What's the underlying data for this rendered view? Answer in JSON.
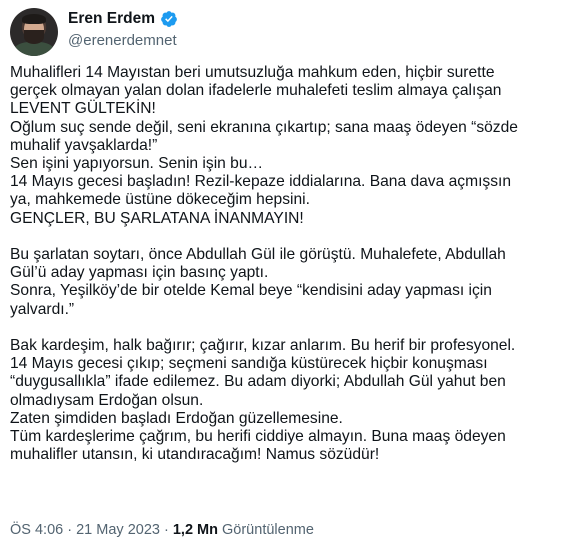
{
  "author": {
    "display_name": "Eren Erdem",
    "handle": "@erenerdemnet",
    "verified_icon": "verified-badge-icon",
    "verified_color": "#1d9bf0"
  },
  "tweet": {
    "lines": [
      "Muhalifleri 14 Mayıstan beri umutsuzluğa mahkum eden, hiçbir surette",
      "gerçek olmayan yalan dolan ifadelerle muhalefeti teslim almaya çalışan",
      "LEVENT GÜLTEKİN!",
      "Oğlum suç sende değil, seni ekranına çıkartıp; sana maaş ödeyen “sözde",
      "muhalif yavşaklarda!”",
      "Sen işini yapıyorsun. Senin işin bu…",
      "14 Mayıs gecesi başladın! Rezil-kepaze iddialarına. Bana dava açmışsın",
      "ya, mahkemede üstüne dökeceğim hepsini.",
      "GENÇLER, BU ŞARLATANA İNANMAYIN!",
      "",
      "Bu şarlatan soytarı, önce Abdullah Gül ile görüştü. Muhalefete, Abdullah",
      "Gül’ü aday yapması için basınç yaptı.",
      "Sonra, Yeşilköy’de bir otelde Kemal beye “kendisini aday yapması için",
      "yalvardı.”",
      "",
      "Bak kardeşim, halk bağırır; çağırır, kızar anlarım. Bu herif bir profesyonel.",
      "14 Mayıs gecesi çıkıp; seçmeni sandığa küstürecek hiçbir konuşması",
      "“duygusallıkla” ifade edilemez. Bu adam diyorki; Abdullah Gül yahut ben",
      "olmadıysam Erdoğan olsun.",
      "Zaten şimdiden başladı Erdoğan güzellemesine.",
      "Tüm kardeşlerime çağrım, bu herifi ciddiye almayın. Buna maaş ödeyen",
      "muhalifler utansın, ki utandıracağım! Namus sözüdür!"
    ]
  },
  "meta": {
    "time": "ÖS 4:06",
    "separator": "·",
    "date": "21 May 2023",
    "views_count": "1,2 Mn",
    "views_label": "Görüntülenme"
  }
}
